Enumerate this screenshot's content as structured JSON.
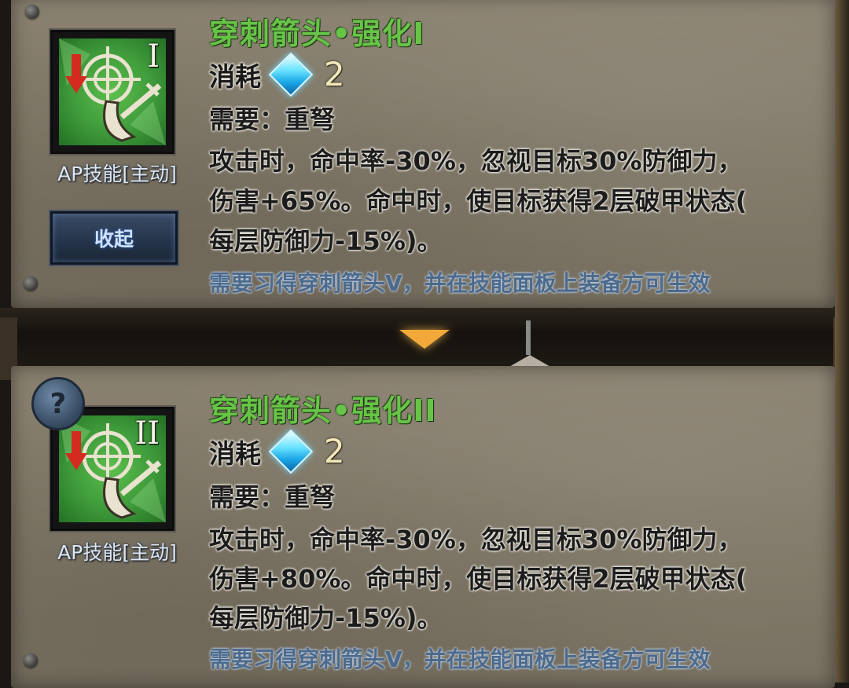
{
  "skills": [
    {
      "title": "穿刺箭头•强化I",
      "icon_numeral": "I",
      "skill_type": "AP技能[主动]",
      "cost_label": "消耗",
      "cost_icon": "crystal-gem-icon",
      "cost_value": "2",
      "requirement": "需要：重弩",
      "description_lines": [
        "攻击时，命中率-30%，忽视目标30%防御力，",
        "伤害+65%。命中时，使目标获得2层破甲状态(",
        "每层防御力-15%)。"
      ],
      "note": "需要习得穿刺箭头V，并在技能面板上装备方可生效",
      "collapse_button": "收起"
    },
    {
      "title": "穿刺箭头•强化II",
      "icon_numeral": "II",
      "skill_type": "AP技能[主动]",
      "cost_label": "消耗",
      "cost_icon": "crystal-gem-icon",
      "cost_value": "2",
      "requirement": "需要：重弩",
      "description_lines": [
        "攻击时，命中率-30%，忽视目标30%防御力，",
        "伤害+80%。命中时，使目标获得2层破甲状态(",
        "每层防御力-15%)。"
      ],
      "note": "需要习得穿刺箭头V，并在技能面板上装备方可生效",
      "help_button": "?"
    }
  ],
  "colors": {
    "title_green": "#67c447",
    "note_blue": "#4c6a8c",
    "arrow_orange": "#f2a93a"
  }
}
